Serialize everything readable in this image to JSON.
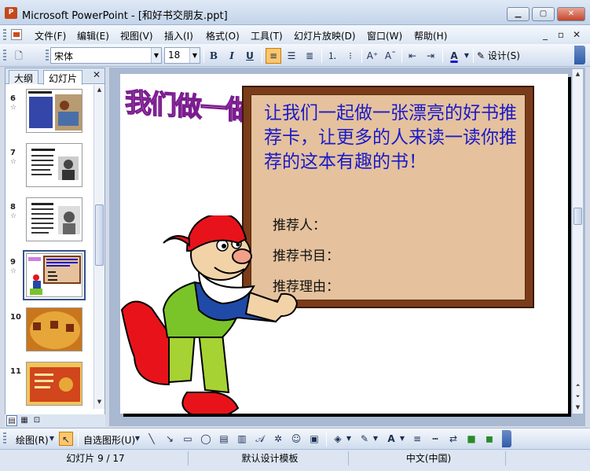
{
  "window": {
    "title": "Microsoft PowerPoint - [和好书交朋友.ppt]",
    "icon": "powerpoint-icon"
  },
  "menu": {
    "items": [
      {
        "label": "文件(F)"
      },
      {
        "label": "编辑(E)"
      },
      {
        "label": "视图(V)"
      },
      {
        "label": "插入(I)"
      },
      {
        "label": "格式(O)"
      },
      {
        "label": "工具(T)"
      },
      {
        "label": "幻灯片放映(D)"
      },
      {
        "label": "窗口(W)"
      },
      {
        "label": "帮助(H)"
      }
    ]
  },
  "toolbar": {
    "font_name": "宋体",
    "font_size": "18",
    "bold": "B",
    "italic": "I",
    "underline": "U",
    "design_label": "设计(S)",
    "active_align": "align-left"
  },
  "pane": {
    "tabs": [
      {
        "label": "大纲"
      },
      {
        "label": "幻灯片"
      }
    ],
    "close": "✕",
    "slides": [
      {
        "num": "6",
        "star": "☆"
      },
      {
        "num": "7",
        "star": "☆"
      },
      {
        "num": "8",
        "star": "☆"
      },
      {
        "num": "9",
        "star": "☆",
        "selected": true
      },
      {
        "num": "10",
        "star": ""
      },
      {
        "num": "11",
        "star": ""
      }
    ]
  },
  "slide": {
    "heading": "我们做一做",
    "board_title": "让我们一起做一张漂亮的好书推荐卡，让更多的人来读一读你推荐的这本有趣的书！",
    "field_recommender": "推荐人：",
    "field_book": "推荐书目：",
    "field_reason": "推荐理由："
  },
  "drawbar": {
    "draw_label": "绘图(R)",
    "autoshape_label": "自选图形(U)"
  },
  "status": {
    "slide_info": "幻灯片 9 / 17",
    "template": "默认设计模板",
    "language": "中文(中国)"
  },
  "colors": {
    "board_frame": "#7a3c1a",
    "board_fill": "#e5c29d",
    "title_text": "#1a1ac8",
    "heading_art": "#e08ce6"
  }
}
